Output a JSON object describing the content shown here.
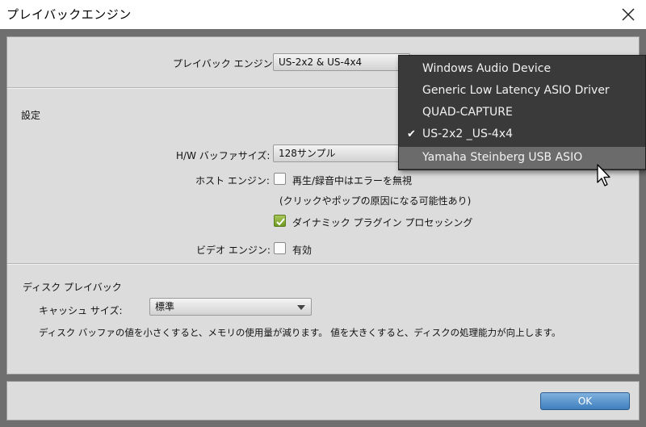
{
  "window": {
    "title": "プレイバックエンジン"
  },
  "playback": {
    "engine_label": "プレイバック エンジン:",
    "engine_value": "US-2x2 & US-4x4"
  },
  "settings": {
    "header": "設定",
    "buffer_label": "H/W バッファサイズ:",
    "buffer_value": "128サンプル",
    "host_label": "ホスト エンジン:",
    "host_option": "再生/録音中はエラーを無視",
    "host_note": "(クリックやポップの原因になる可能性あり)",
    "host_checked": false,
    "dynamic_option": "ダイナミック プラグイン プロセッシング",
    "dynamic_checked": true,
    "video_label": "ビデオ エンジン:",
    "video_option": "有効",
    "video_checked": false
  },
  "disk": {
    "header": "ディスク プレイバック",
    "cache_label": "キャッシュ サイズ:",
    "cache_value": "標準",
    "description": "ディスク バッファの値を小さくすると、メモリの使用量が減ります。 値を大きくすると、ディスクの処理能力が向上します。"
  },
  "footer": {
    "ok_label": "OK"
  },
  "dropdown": {
    "items": [
      {
        "label": "Windows Audio Device",
        "checked": false,
        "highlighted": false
      },
      {
        "label": "Generic Low Latency ASIO Driver",
        "checked": false,
        "highlighted": false
      },
      {
        "label": "QUAD-CAPTURE",
        "checked": false,
        "highlighted": false
      },
      {
        "label": "US-2x2 _US-4x4",
        "checked": true,
        "highlighted": false
      },
      {
        "label": "Yamaha Steinberg USB ASIO",
        "checked": false,
        "highlighted": true
      }
    ],
    "check_mark": "✔"
  },
  "colors": {
    "menu_bg": "#3a3a3a",
    "menu_highlight": "#6b6b6b",
    "ok_button": "#4f8bc6",
    "checkbox_on": "#8db33f"
  }
}
